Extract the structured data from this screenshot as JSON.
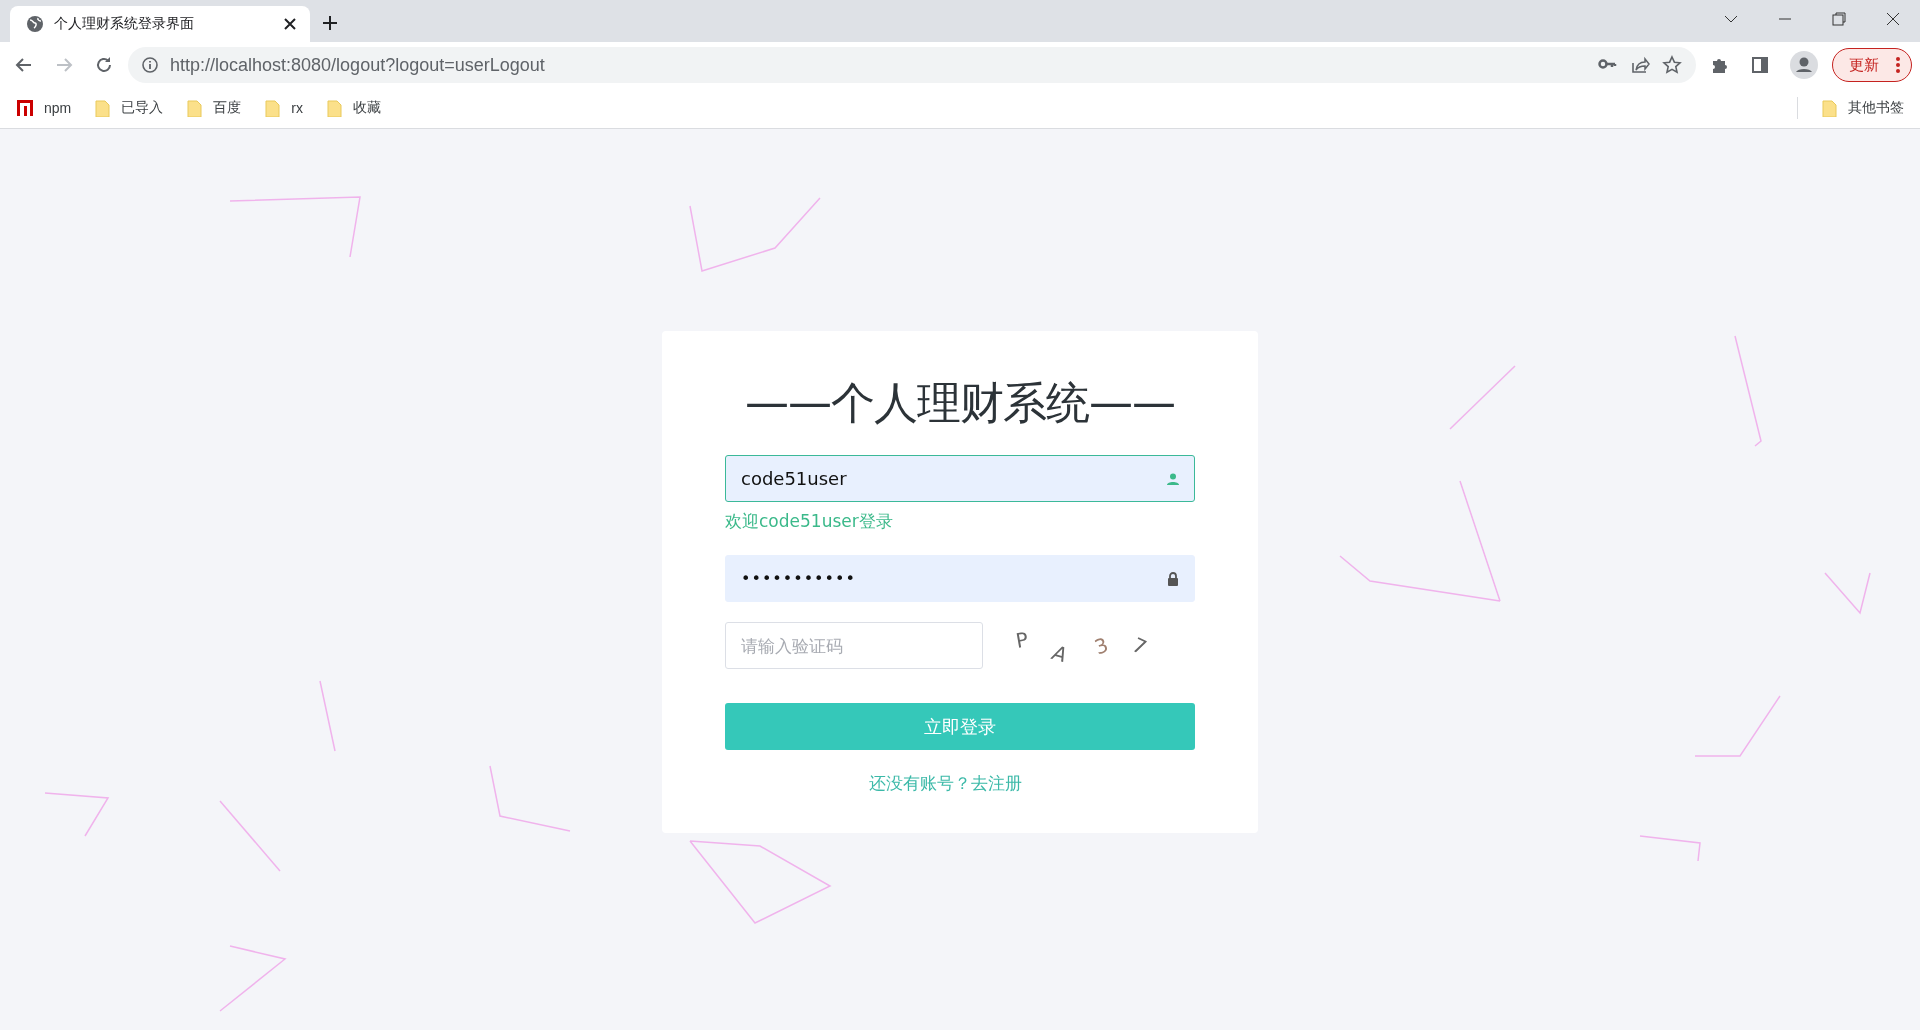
{
  "browser": {
    "tab_title": "个人理财系统登录界面",
    "address": "http://localhost:8080/logout?logout=userLogout",
    "update_button": "更新",
    "bookmarks": [
      {
        "kind": "npm",
        "label": "npm"
      },
      {
        "kind": "folder",
        "label": "已导入"
      },
      {
        "kind": "folder",
        "label": "百度"
      },
      {
        "kind": "folder",
        "label": "rx"
      },
      {
        "kind": "folder",
        "label": "收藏"
      }
    ],
    "other_bookmarks": "其他书签"
  },
  "login": {
    "title": "——个人理财系统——",
    "username": {
      "value": "code51user"
    },
    "welcome": "欢迎code51user登录",
    "password": {
      "value": "•••••••••••"
    },
    "captcha": {
      "placeholder": "请输入验证码",
      "characters": [
        "P",
        "A",
        "3",
        "7"
      ]
    },
    "login_button": "立即登录",
    "register_link": "还没有账号？去注册"
  }
}
